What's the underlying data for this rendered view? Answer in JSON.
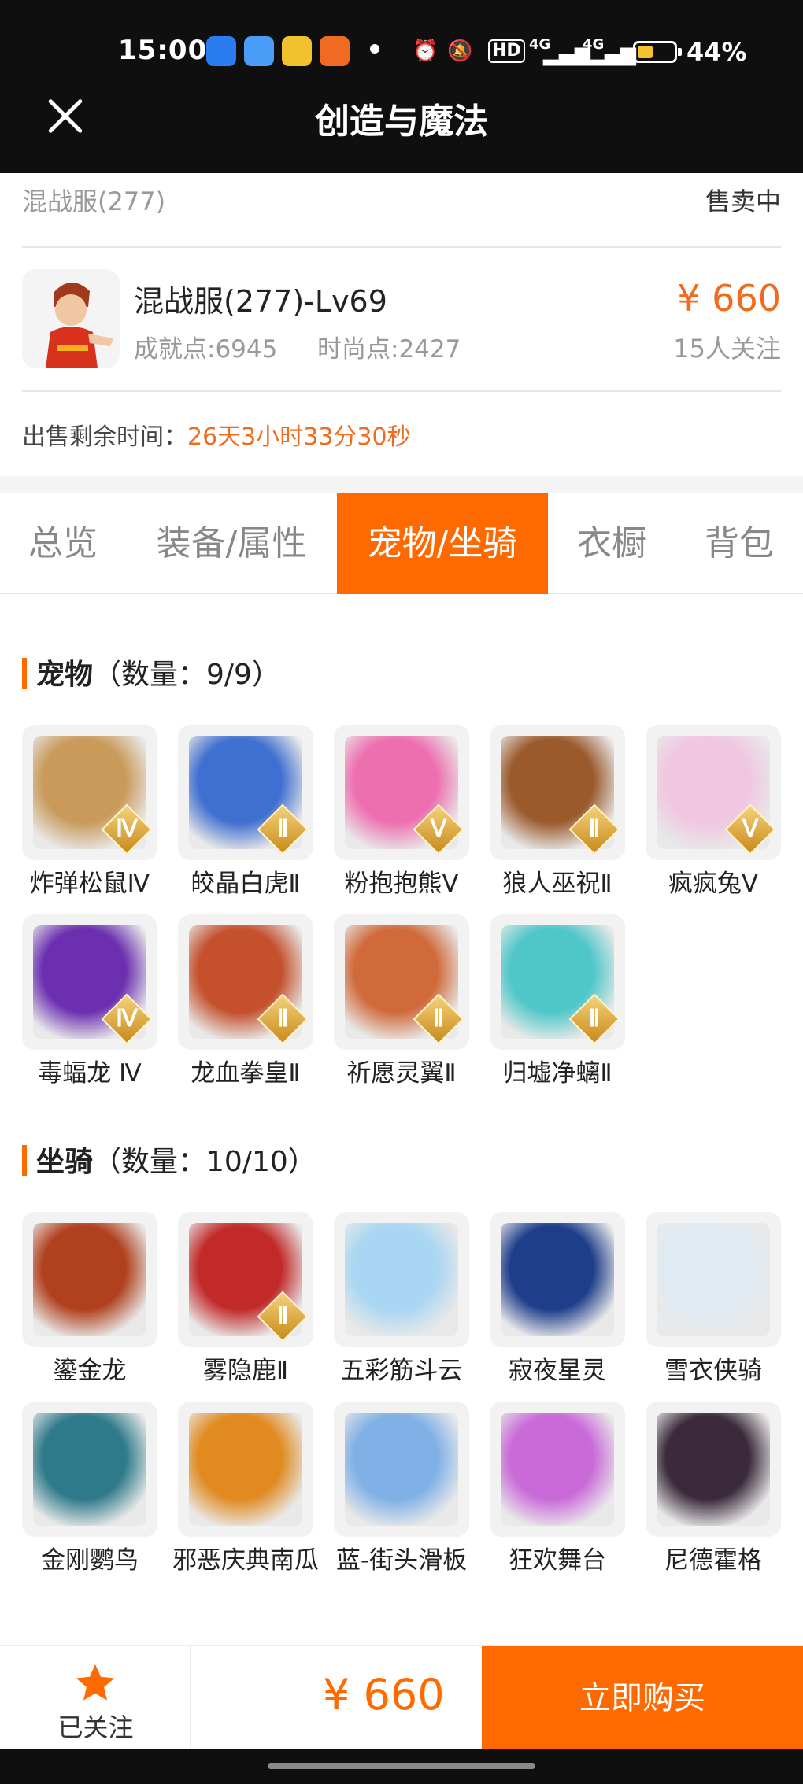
{
  "status_bar": {
    "time": "15:00",
    "network_1": "4G",
    "network_2": "4G",
    "hd_label": "HD",
    "battery": "44%",
    "battery_level": 0.44
  },
  "header": {
    "title": "创造与魔法"
  },
  "listing": {
    "server": "混战服(277)",
    "sale_status": "售卖中",
    "character_title": "混战服(277)-Lv69",
    "achievement": "成就点:6945",
    "fashion": "时尚点:2427",
    "price": "¥ 660",
    "followers": "15人关注",
    "remaining_label": "出售剩余时间：",
    "remaining_value": "26天3小时33分30秒"
  },
  "tabs": [
    {
      "label": "总览"
    },
    {
      "label": "装备/属性"
    },
    {
      "label": "宠物/坐骑"
    },
    {
      "label": "衣橱"
    },
    {
      "label": "背包"
    }
  ],
  "pets": {
    "title": "宠物",
    "count": "（数量：9/9）",
    "items": [
      {
        "name": "炸弹松鼠Ⅳ",
        "tier": "Ⅳ",
        "color": "#c99a5a"
      },
      {
        "name": "皎晶白虎Ⅱ",
        "tier": "Ⅱ",
        "color": "#3f6fd0"
      },
      {
        "name": "粉抱抱熊Ⅴ",
        "tier": "Ⅴ",
        "color": "#ee6fb0"
      },
      {
        "name": "狼人巫祝Ⅱ",
        "tier": "Ⅱ",
        "color": "#9a5a2c"
      },
      {
        "name": "疯疯兔Ⅴ",
        "tier": "Ⅴ",
        "color": "#f0c6e0"
      },
      {
        "name": "毒蝠龙 Ⅳ",
        "tier": "Ⅳ",
        "color": "#6b2fb0"
      },
      {
        "name": "龙血拳皇Ⅱ",
        "tier": "Ⅱ",
        "color": "#c4502c"
      },
      {
        "name": "祈愿灵翼Ⅱ",
        "tier": "Ⅱ",
        "color": "#d06a3a"
      },
      {
        "name": "归墟净螭Ⅱ",
        "tier": "Ⅱ",
        "color": "#4fc7c9"
      }
    ]
  },
  "mounts": {
    "title": "坐骑",
    "count": "（数量：10/10）",
    "items": [
      {
        "name": "鎏金龙",
        "tier": "",
        "color": "#b0401e"
      },
      {
        "name": "雾隐鹿Ⅱ",
        "tier": "Ⅱ",
        "color": "#c22a2a"
      },
      {
        "name": "五彩筋斗云",
        "tier": "",
        "color": "#a9d6f2"
      },
      {
        "name": "寂夜星灵",
        "tier": "",
        "color": "#1e3d8a"
      },
      {
        "name": "雪衣侠骑",
        "tier": "",
        "color": "#dfeaf2"
      },
      {
        "name": "金刚鹦鸟",
        "tier": "",
        "color": "#2f7a8a"
      },
      {
        "name": "邪恶庆典南瓜",
        "tier": "",
        "color": "#e08a20"
      },
      {
        "name": "蓝-街头滑板",
        "tier": "",
        "color": "#7fb0e6"
      },
      {
        "name": "狂欢舞台",
        "tier": "",
        "color": "#c96ad8"
      },
      {
        "name": "尼德霍格",
        "tier": "",
        "color": "#3a2a3a"
      }
    ]
  },
  "bottom_bar": {
    "follow_label": "已关注",
    "price": "¥ 660",
    "buy_label": "立即购买"
  },
  "colors": {
    "accent": "#ff6a00",
    "price_text": "#f26b1d",
    "header_bg": "#0f0f0f"
  }
}
